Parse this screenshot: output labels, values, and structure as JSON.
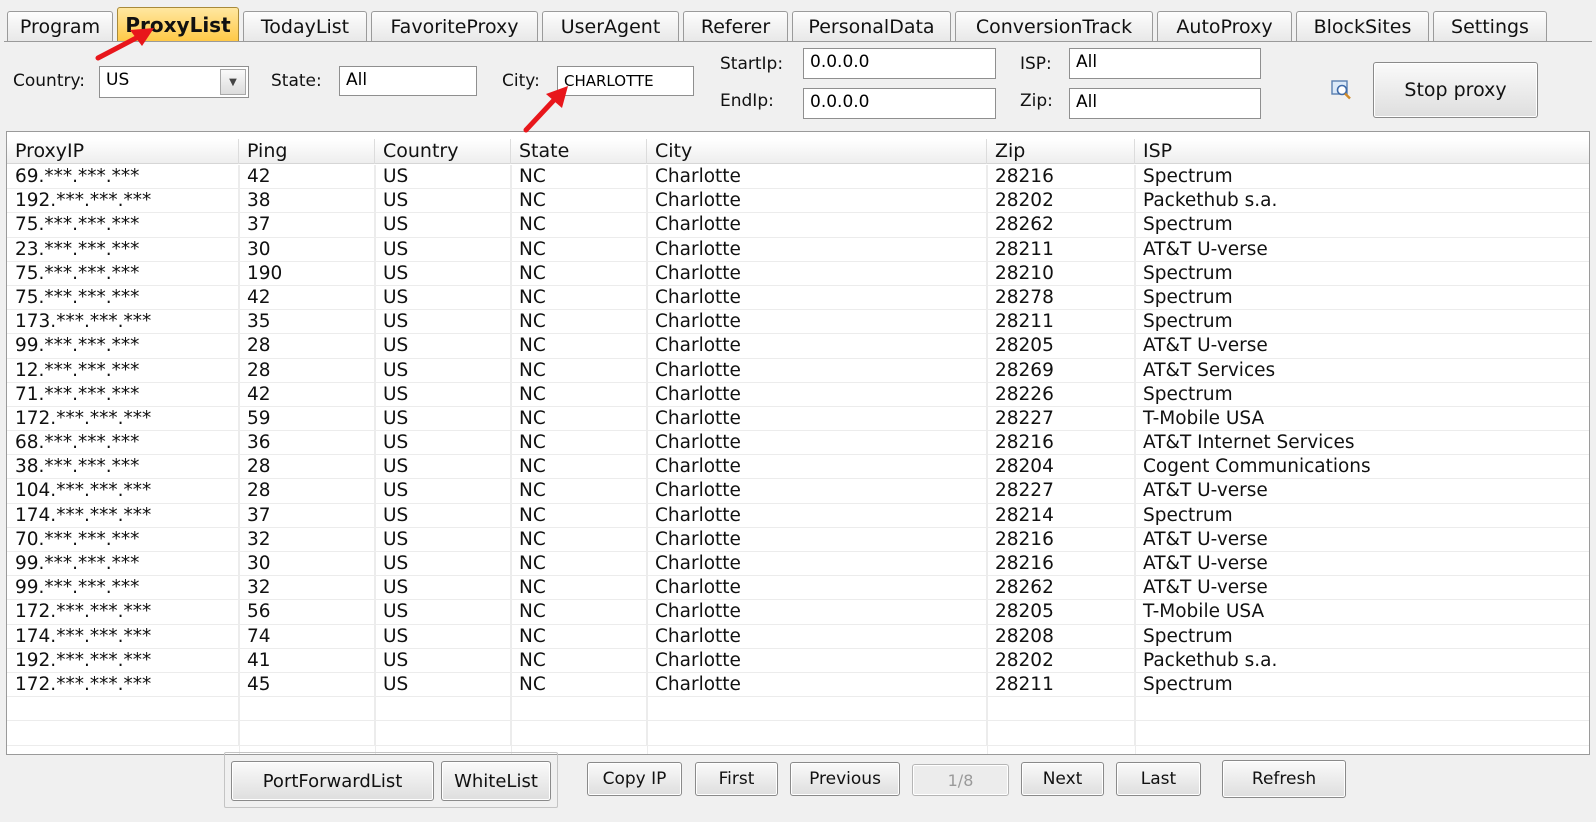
{
  "tabs": [
    {
      "label": "Program",
      "active": false
    },
    {
      "label": "ProxyList",
      "active": true
    },
    {
      "label": "TodayList",
      "active": false
    },
    {
      "label": "FavoriteProxy",
      "active": false
    },
    {
      "label": "UserAgent",
      "active": false
    },
    {
      "label": "Referer",
      "active": false
    },
    {
      "label": "PersonalData",
      "active": false
    },
    {
      "label": "ConversionTrack",
      "active": false
    },
    {
      "label": "AutoProxy",
      "active": false
    },
    {
      "label": "BlockSites",
      "active": false
    },
    {
      "label": "Settings",
      "active": false
    }
  ],
  "filters": {
    "country_label": "Country:",
    "country_value": "US",
    "state_label": "State:",
    "state_value": "All",
    "city_label": "City:",
    "city_value": "CHARLOTTE",
    "startip_label": "StartIp:",
    "startip_value": "0.0.0.0",
    "endip_label": "EndIp:",
    "endip_value": "0.0.0.0",
    "isp_label": "ISP:",
    "isp_value": "All",
    "zip_label": "Zip:",
    "zip_value": "All"
  },
  "stop_proxy_label": "Stop proxy",
  "table": {
    "columns": [
      "ProxyIP",
      "Ping",
      "Country",
      "State",
      "City",
      "Zip",
      "ISP"
    ],
    "rows": [
      [
        "69.***.***.***",
        "42",
        "US",
        "NC",
        "Charlotte",
        "28216",
        "Spectrum"
      ],
      [
        "192.***.***.***",
        "38",
        "US",
        "NC",
        "Charlotte",
        "28202",
        "Packethub s.a."
      ],
      [
        "75.***.***.***",
        "37",
        "US",
        "NC",
        "Charlotte",
        "28262",
        "Spectrum"
      ],
      [
        "23.***.***.***",
        "30",
        "US",
        "NC",
        "Charlotte",
        "28211",
        "AT&T U-verse"
      ],
      [
        "75.***.***.***",
        "190",
        "US",
        "NC",
        "Charlotte",
        "28210",
        "Spectrum"
      ],
      [
        "75.***.***.***",
        "42",
        "US",
        "NC",
        "Charlotte",
        "28278",
        "Spectrum"
      ],
      [
        "173.***.***.***",
        "35",
        "US",
        "NC",
        "Charlotte",
        "28211",
        "Spectrum"
      ],
      [
        "99.***.***.***",
        "28",
        "US",
        "NC",
        "Charlotte",
        "28205",
        "AT&T U-verse"
      ],
      [
        "12.***.***.***",
        "28",
        "US",
        "NC",
        "Charlotte",
        "28269",
        "AT&T Services"
      ],
      [
        "71.***.***.***",
        "42",
        "US",
        "NC",
        "Charlotte",
        "28226",
        "Spectrum"
      ],
      [
        "172.***.***.***",
        "59",
        "US",
        "NC",
        "Charlotte",
        "28227",
        "T-Mobile USA"
      ],
      [
        "68.***.***.***",
        "36",
        "US",
        "NC",
        "Charlotte",
        "28216",
        "AT&T Internet Services"
      ],
      [
        "38.***.***.***",
        "28",
        "US",
        "NC",
        "Charlotte",
        "28204",
        "Cogent Communications"
      ],
      [
        "104.***.***.***",
        "28",
        "US",
        "NC",
        "Charlotte",
        "28227",
        "AT&T U-verse"
      ],
      [
        "174.***.***.***",
        "37",
        "US",
        "NC",
        "Charlotte",
        "28214",
        "Spectrum"
      ],
      [
        "70.***.***.***",
        "32",
        "US",
        "NC",
        "Charlotte",
        "28216",
        "AT&T U-verse"
      ],
      [
        "99.***.***.***",
        "30",
        "US",
        "NC",
        "Charlotte",
        "28216",
        "AT&T U-verse"
      ],
      [
        "99.***.***.***",
        "32",
        "US",
        "NC",
        "Charlotte",
        "28262",
        "AT&T U-verse"
      ],
      [
        "172.***.***.***",
        "56",
        "US",
        "NC",
        "Charlotte",
        "28205",
        "T-Mobile USA"
      ],
      [
        "174.***.***.***",
        "74",
        "US",
        "NC",
        "Charlotte",
        "28208",
        "Spectrum"
      ],
      [
        "192.***.***.***",
        "41",
        "US",
        "NC",
        "Charlotte",
        "28202",
        "Packethub s.a."
      ],
      [
        "172.***.***.***",
        "45",
        "US",
        "NC",
        "Charlotte",
        "28211",
        "Spectrum"
      ]
    ]
  },
  "bottom": {
    "portforward_label": "PortForwardList",
    "whitelist_label": "WhiteList",
    "copy_ip_label": "Copy IP",
    "first_label": "First",
    "previous_label": "Previous",
    "page_indicator": "1/8",
    "next_label": "Next",
    "last_label": "Last",
    "refresh_label": "Refresh"
  },
  "colors": {
    "active_tab": "#ffc844",
    "annotation_arrow": "#e8161b"
  },
  "icons": {
    "search": "search-icon",
    "combo": "chevron-down-icon",
    "annotation": "red-arrow-icon"
  }
}
